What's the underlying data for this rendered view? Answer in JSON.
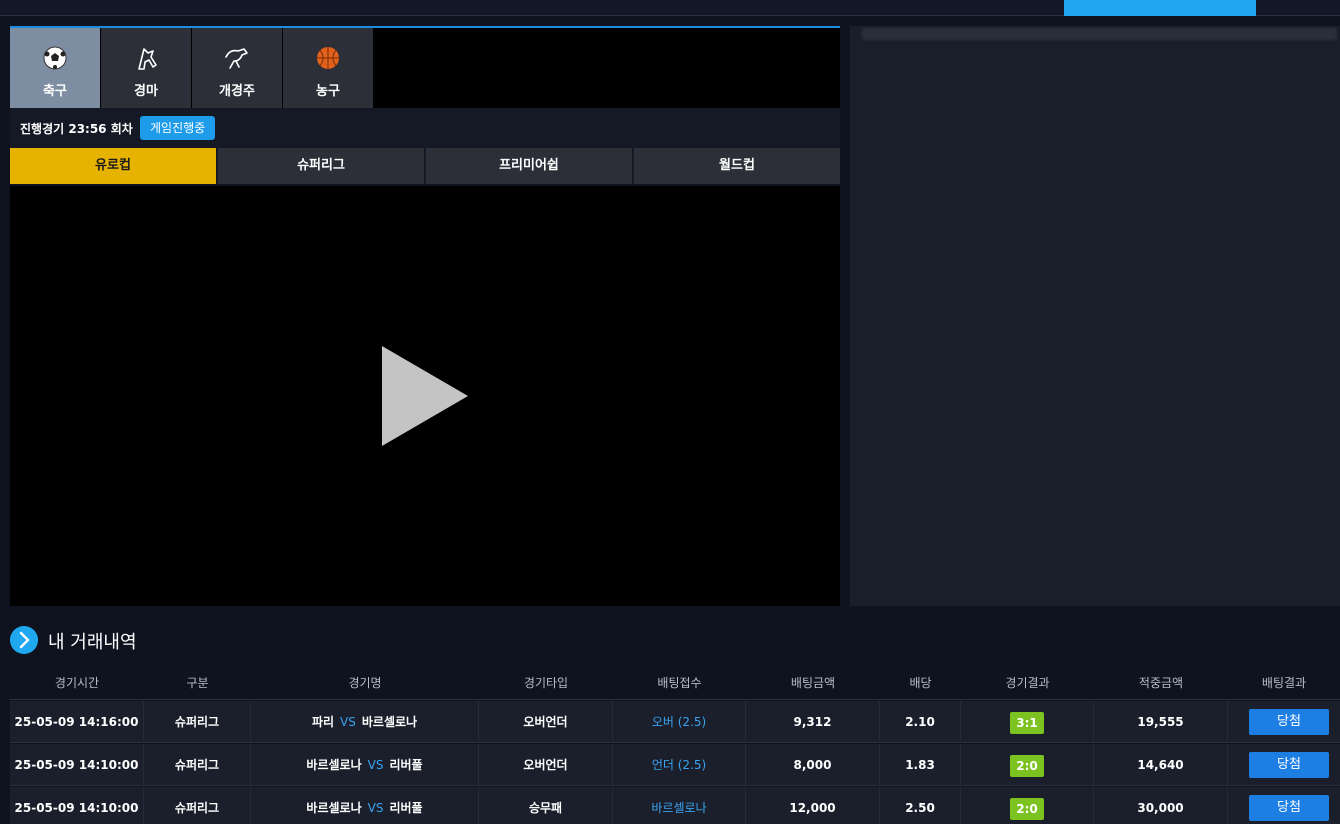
{
  "colors": {
    "accent": "#1fa8ef",
    "league_active": "#e6b400",
    "score_green": "#7cc220",
    "win_blue": "#1d7fe4",
    "link_blue": "#3aa3f0"
  },
  "sports": [
    {
      "label": "축구",
      "icon": "soccer-ball-icon",
      "active": true
    },
    {
      "label": "경마",
      "icon": "horse-racing-icon",
      "active": false
    },
    {
      "label": "개경주",
      "icon": "greyhound-icon",
      "active": false
    },
    {
      "label": "농구",
      "icon": "basketball-icon",
      "active": false
    }
  ],
  "status": {
    "text": "진행경기 23:56 회차",
    "badge": "게임진행중"
  },
  "leagues": [
    {
      "label": "유로컵",
      "active": true
    },
    {
      "label": "슈퍼리그",
      "active": false
    },
    {
      "label": "프리미어쉽",
      "active": false
    },
    {
      "label": "월드컵",
      "active": false
    }
  ],
  "history": {
    "title": "내 거래내역",
    "columns": [
      "경기시간",
      "구분",
      "경기명",
      "경기타입",
      "배팅접수",
      "배팅금액",
      "배당",
      "경기결과",
      "적중금액",
      "배팅결과"
    ],
    "rows": [
      {
        "time": "25-05-09 14:16:00",
        "league": "슈퍼리그",
        "home": "파리",
        "vs": "VS",
        "away": "바르셀로나",
        "type": "오버언더",
        "pick": "오버 (2.5)",
        "amount": "9,312",
        "odds": "2.10",
        "score": "3:1",
        "payout": "19,555",
        "result": "당첨"
      },
      {
        "time": "25-05-09 14:10:00",
        "league": "슈퍼리그",
        "home": "바르셀로나",
        "vs": "VS",
        "away": "리버풀",
        "type": "오버언더",
        "pick": "언더 (2.5)",
        "amount": "8,000",
        "odds": "1.83",
        "score": "2:0",
        "payout": "14,640",
        "result": "당첨"
      },
      {
        "time": "25-05-09 14:10:00",
        "league": "슈퍼리그",
        "home": "바르셀로나",
        "vs": "VS",
        "away": "리버풀",
        "type": "승무패",
        "pick": "바르셀로나",
        "amount": "12,000",
        "odds": "2.50",
        "score": "2:0",
        "payout": "30,000",
        "result": "당첨"
      }
    ]
  }
}
